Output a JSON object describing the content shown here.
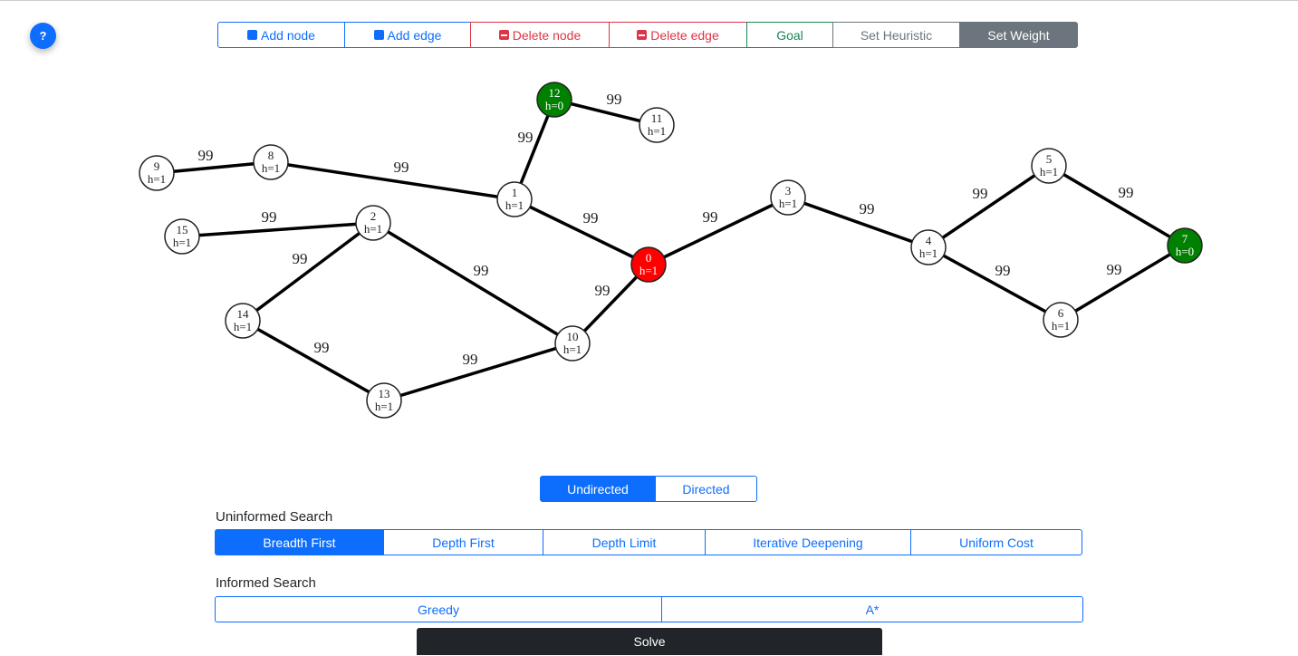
{
  "help_label": "?",
  "toolbar": [
    {
      "label": "Add node",
      "style": "blue",
      "icon": "square-icon"
    },
    {
      "label": "Add edge",
      "style": "blue",
      "icon": "square-icon"
    },
    {
      "label": "Delete node",
      "style": "red",
      "icon": "minus-square-icon"
    },
    {
      "label": "Delete edge",
      "style": "red",
      "icon": "minus-square-icon"
    },
    {
      "label": "Goal",
      "style": "green"
    },
    {
      "label": "Set Heuristic",
      "style": "grey"
    },
    {
      "label": "Set Weight",
      "style": "grey",
      "active": true
    }
  ],
  "graph": {
    "colors": {
      "start": "#ff0000",
      "goal": "#008000",
      "default": "#ffffff"
    },
    "nodes": [
      {
        "id": "0",
        "h": "h=1",
        "type": "start"
      },
      {
        "id": "1",
        "h": "h=1"
      },
      {
        "id": "2",
        "h": "h=1"
      },
      {
        "id": "3",
        "h": "h=1"
      },
      {
        "id": "4",
        "h": "h=1"
      },
      {
        "id": "5",
        "h": "h=1"
      },
      {
        "id": "6",
        "h": "h=1"
      },
      {
        "id": "7",
        "h": "h=0",
        "type": "goal"
      },
      {
        "id": "8",
        "h": "h=1"
      },
      {
        "id": "9",
        "h": "h=1"
      },
      {
        "id": "10",
        "h": "h=1"
      },
      {
        "id": "11",
        "h": "h=1"
      },
      {
        "id": "12",
        "h": "h=0",
        "type": "goal"
      },
      {
        "id": "13",
        "h": "h=1"
      },
      {
        "id": "14",
        "h": "h=1"
      },
      {
        "id": "15",
        "h": "h=1"
      }
    ],
    "edges": [
      {
        "from": "12",
        "to": "11",
        "weight": "99"
      },
      {
        "from": "12",
        "to": "1",
        "weight": "99"
      },
      {
        "from": "9",
        "to": "8",
        "weight": "99"
      },
      {
        "from": "8",
        "to": "1",
        "weight": "99"
      },
      {
        "from": "1",
        "to": "0",
        "weight": "99"
      },
      {
        "from": "0",
        "to": "3",
        "weight": "99"
      },
      {
        "from": "3",
        "to": "4",
        "weight": "99"
      },
      {
        "from": "4",
        "to": "5",
        "weight": "99"
      },
      {
        "from": "5",
        "to": "7",
        "weight": "99"
      },
      {
        "from": "4",
        "to": "6",
        "weight": "99"
      },
      {
        "from": "6",
        "to": "7",
        "weight": "99"
      },
      {
        "from": "0",
        "to": "10",
        "weight": "99"
      },
      {
        "from": "15",
        "to": "2",
        "weight": "99"
      },
      {
        "from": "2",
        "to": "14",
        "weight": "99"
      },
      {
        "from": "2",
        "to": "10",
        "weight": "99"
      },
      {
        "from": "14",
        "to": "13",
        "weight": "99"
      },
      {
        "from": "13",
        "to": "10",
        "weight": "99"
      }
    ]
  },
  "mode": {
    "options": [
      "Undirected",
      "Directed"
    ],
    "selected": "Undirected"
  },
  "uninformed": {
    "title": "Uninformed Search",
    "options": [
      "Breadth First",
      "Depth First",
      "Depth Limit",
      "Iterative Deepening",
      "Uniform Cost"
    ],
    "selected": "Breadth First"
  },
  "informed": {
    "title": "Informed Search",
    "options": [
      "Greedy",
      "A*"
    ]
  },
  "solve_label": "Solve"
}
